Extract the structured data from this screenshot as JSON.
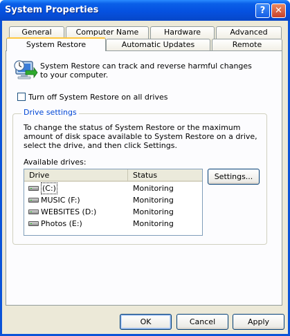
{
  "window": {
    "title": "System Properties",
    "help_glyph": "?",
    "close_glyph": "✕"
  },
  "tabs": {
    "row_back": [
      "General",
      "Computer Name",
      "Hardware",
      "Advanced"
    ],
    "row_front": [
      "System Restore",
      "Automatic Updates",
      "Remote"
    ],
    "active": "System Restore"
  },
  "intro_text": "System Restore can track and reverse harmful changes to your computer.",
  "turn_off_checkbox": {
    "label": "Turn off System Restore on all drives",
    "checked": false
  },
  "drive_settings": {
    "title": "Drive settings",
    "description": "To change the status of System Restore or the maximum amount of disk space available to System Restore on a drive, select the drive, and then click Settings.",
    "available_label": "Available drives:",
    "columns": [
      "Drive",
      "Status"
    ],
    "drives": [
      {
        "name": " (C:)",
        "status": "Monitoring",
        "selected": true
      },
      {
        "name": "MUSIC (F:)",
        "status": "Monitoring"
      },
      {
        "name": "WEBSITES (D:)",
        "status": "Monitoring"
      },
      {
        "name": "Photos (E:)",
        "status": "Monitoring"
      }
    ],
    "settings_button": "Settings..."
  },
  "buttons": {
    "ok": "OK",
    "cancel": "Cancel",
    "apply": "Apply"
  },
  "colors": {
    "title_bar": "#0551e0",
    "group_title": "#0046d5",
    "active_tab_accent": "#ffc73c",
    "dialog_face": "#ece9d8"
  }
}
